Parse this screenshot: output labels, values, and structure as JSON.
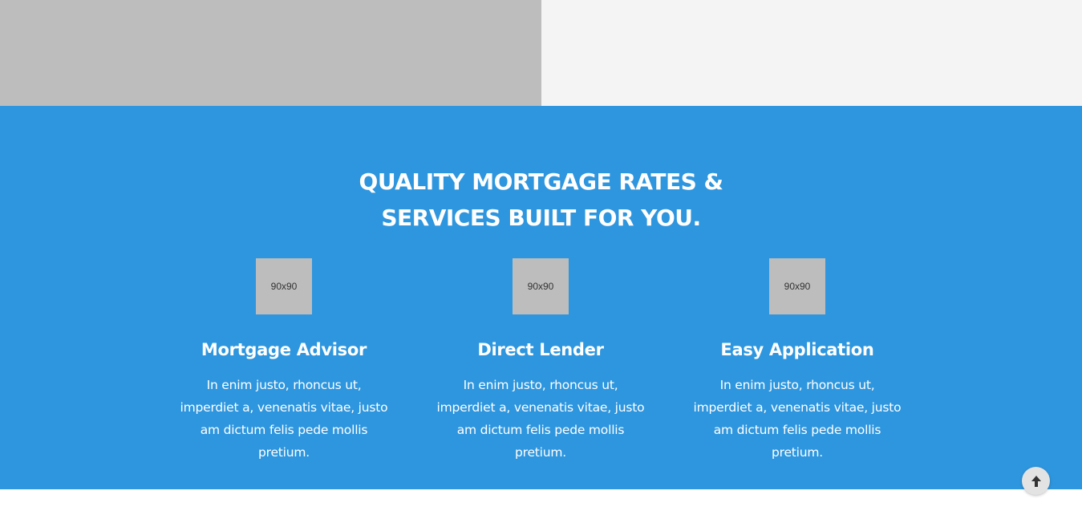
{
  "hero_top": {
    "left_color": "#bdbdbd",
    "right_color": "#f4f4f4"
  },
  "services": {
    "background_color": "#2e96de",
    "title_line1": "QUALITY MORTGAGE RATES &",
    "title_line2": "SERVICES BUILT FOR YOU.",
    "features": [
      {
        "image_label": "90x90",
        "title": "Mortgage Advisor",
        "description": "In enim justo, rhoncus ut, imperdiet a, venenatis vitae, justo am dictum felis pede mollis pretium."
      },
      {
        "image_label": "90x90",
        "title": "Direct Lender",
        "description": "In enim justo, rhoncus ut, imperdiet a, venenatis vitae, justo am dictum felis pede mollis pretium."
      },
      {
        "image_label": "90x90",
        "title": "Easy Application",
        "description": "In enim justo, rhoncus ut, imperdiet a, venenatis vitae, justo am dictum felis pede mollis pretium."
      }
    ]
  },
  "scroll_top": {
    "icon": "arrow-up-icon"
  }
}
